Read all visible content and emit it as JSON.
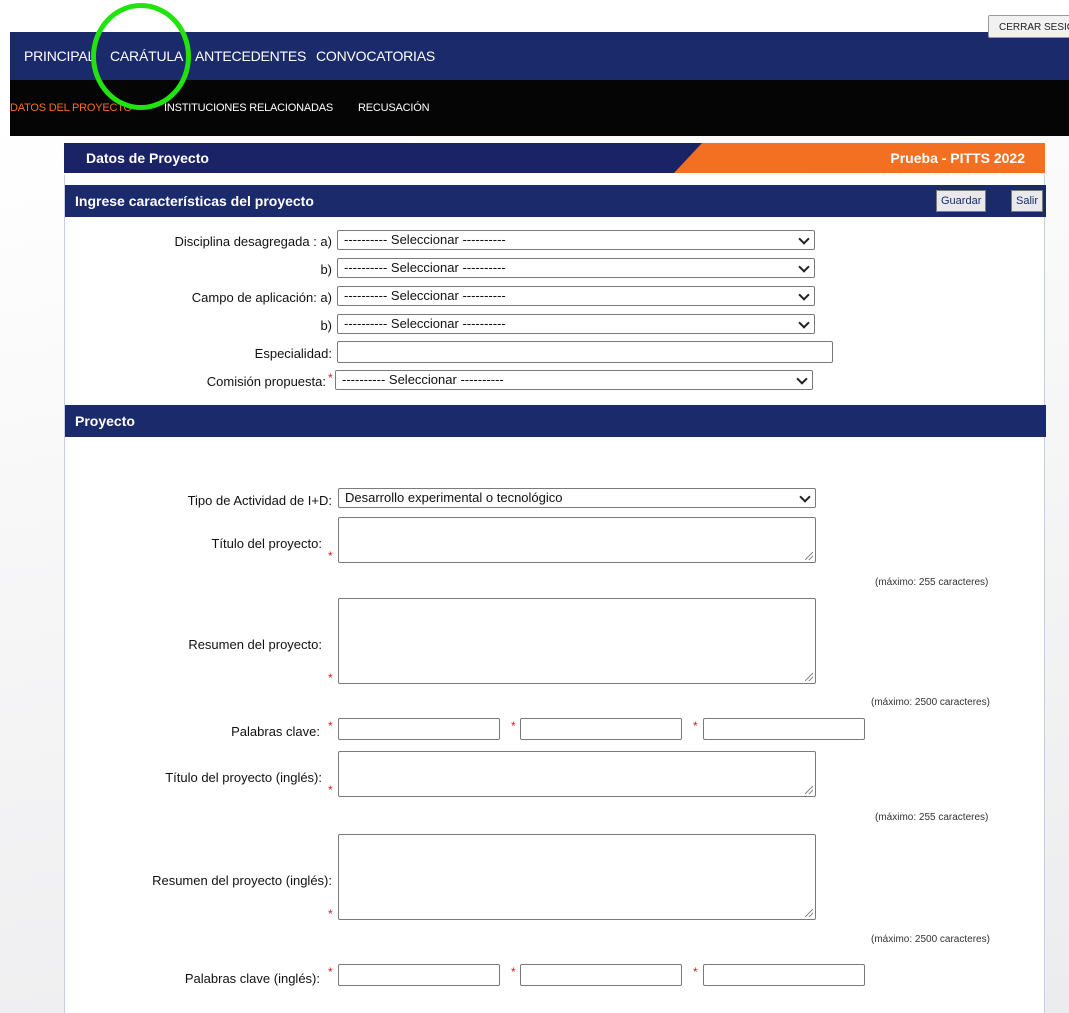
{
  "topnav": {
    "items": [
      "PRINCIPAL",
      "CARÁTULA",
      "ANTECEDENTES",
      "CONVOCATORIAS"
    ],
    "logout_label": "CERRAR SESIÓN"
  },
  "subnav": {
    "items": [
      "DATOS DEL PROYECTO",
      "INSTITUCIONES RELACIONADAS",
      "RECUSACIÓN"
    ]
  },
  "title_bar": {
    "left": "Datos de Proyecto",
    "right": "Prueba - PITTS 2022"
  },
  "section1": {
    "title": "Ingrese características del proyecto",
    "save_label": "Guardar",
    "exit_label": "Salir",
    "disciplina_label": "Disciplina desagregada : a)",
    "b_label": "b)",
    "campo_label": "Campo de aplicación: a)",
    "especialidad_label": "Especialidad:",
    "comision_label": "Comisión propuesta:",
    "select_placeholder": "---------- Seleccionar ----------",
    "required_mark": "*"
  },
  "section2": {
    "title": "Proyecto",
    "tipo_label": "Tipo de Actividad de I+D:",
    "tipo_value": "Desarrollo experimental o tecnológico",
    "titulo_label": "Título del proyecto:",
    "hint_255": "(máximo: 255 caracteres)",
    "resumen_label": "Resumen del proyecto:",
    "hint_2500": "(máximo: 2500 caracteres)",
    "palabras_label": "Palabras clave:",
    "titulo_en_label": "Título del proyecto (inglés):",
    "resumen_en_label": "Resumen del proyecto (inglés):",
    "palabras_en_label": "Palabras clave (inglés):"
  },
  "colors": {
    "navy": "#1b2a6b",
    "orange": "#f36f21",
    "highlight": "#22e30f"
  }
}
